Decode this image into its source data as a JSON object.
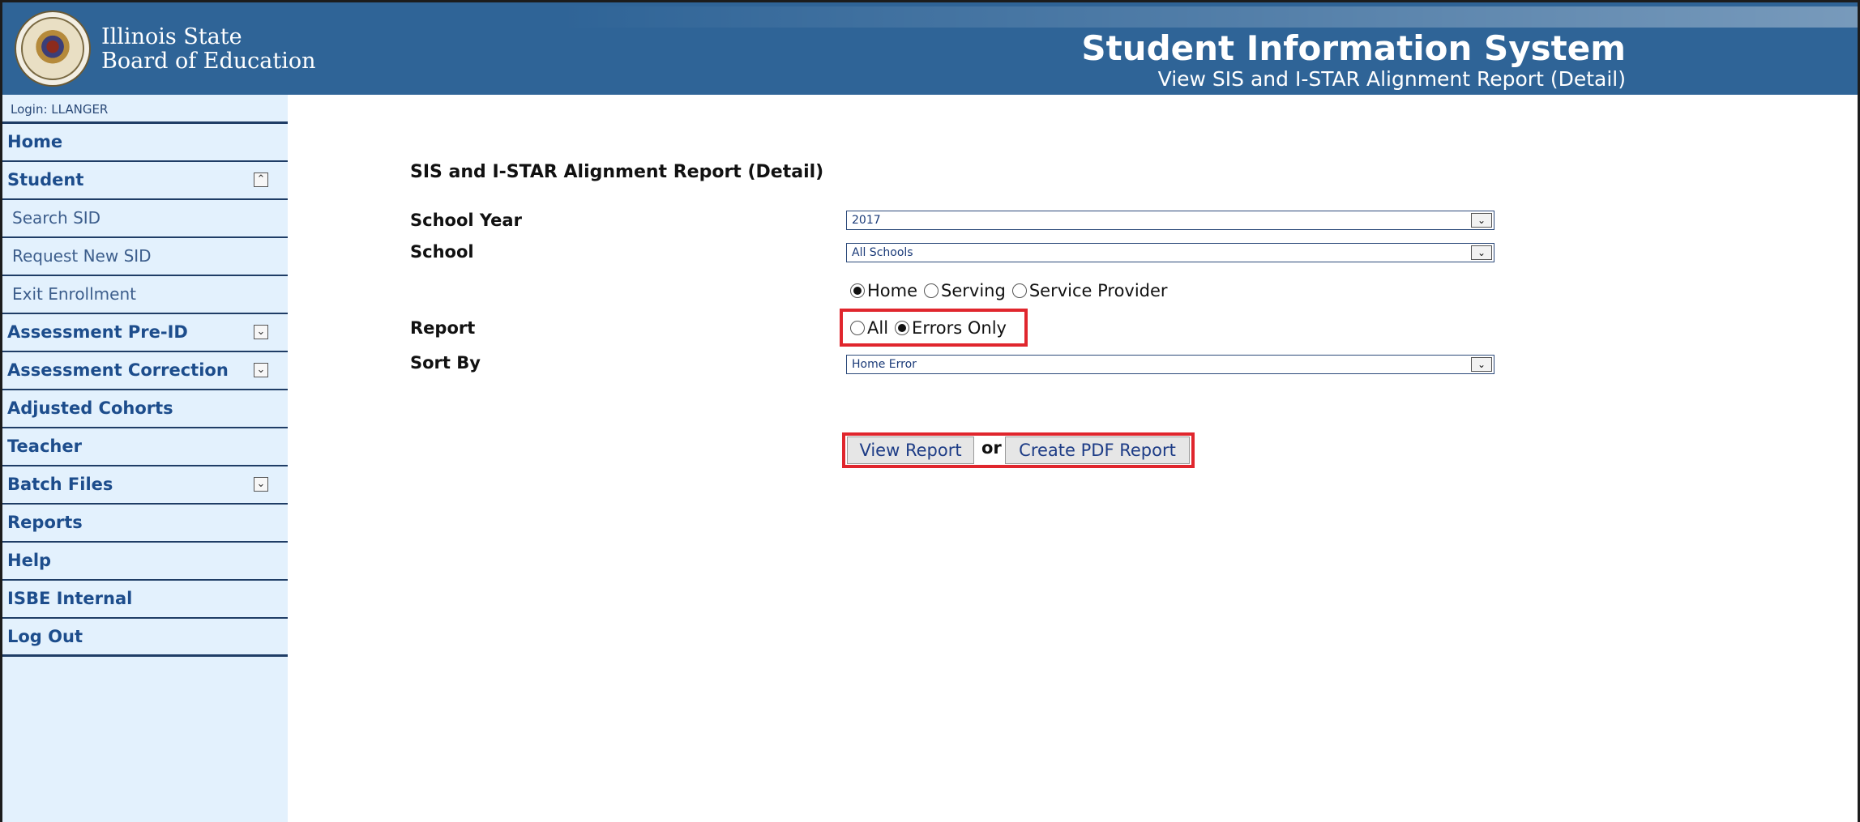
{
  "header": {
    "agency_line1": "Illinois State",
    "agency_line2": "Board of Education",
    "system_title": "Student Information System",
    "page_subtitle": "View SIS and I-STAR Alignment Report (Detail)"
  },
  "sidebar": {
    "login": "Login: LLANGER",
    "items": [
      {
        "label": "Home"
      },
      {
        "label": "Student",
        "toggle": "collapse"
      },
      {
        "label": "Search SID"
      },
      {
        "label": "Request New SID"
      },
      {
        "label": "Exit Enrollment"
      },
      {
        "label": "Assessment Pre-ID",
        "toggle": "expand"
      },
      {
        "label": "Assessment Correction",
        "toggle": "expand"
      },
      {
        "label": "Adjusted Cohorts"
      },
      {
        "label": "Teacher"
      },
      {
        "label": "Batch Files",
        "toggle": "expand"
      },
      {
        "label": "Reports"
      },
      {
        "label": "Help"
      },
      {
        "label": "ISBE Internal"
      },
      {
        "label": "Log Out"
      }
    ],
    "toggle_glyphs": {
      "collapse": "⌃",
      "expand": "⌄"
    }
  },
  "form": {
    "title": "SIS and I-STAR Alignment Report (Detail)",
    "school_year_label": "School Year",
    "school_year_value": "2017",
    "school_label": "School",
    "school_value": "All Schools",
    "school_type_options": [
      "Home",
      "Serving",
      "Service Provider"
    ],
    "school_type_selected": "Home",
    "report_label": "Report",
    "report_options": [
      "All",
      "Errors Only"
    ],
    "report_selected": "Errors Only",
    "sort_by_label": "Sort By",
    "sort_by_value": "Home Error",
    "view_button": "View Report",
    "or_text": "or",
    "pdf_button": "Create PDF Report"
  },
  "colors": {
    "header_bg": "#2f6497",
    "sidebar_bg": "#e3f1fd",
    "highlight": "#e0262d",
    "link": "#1d4d8c"
  }
}
